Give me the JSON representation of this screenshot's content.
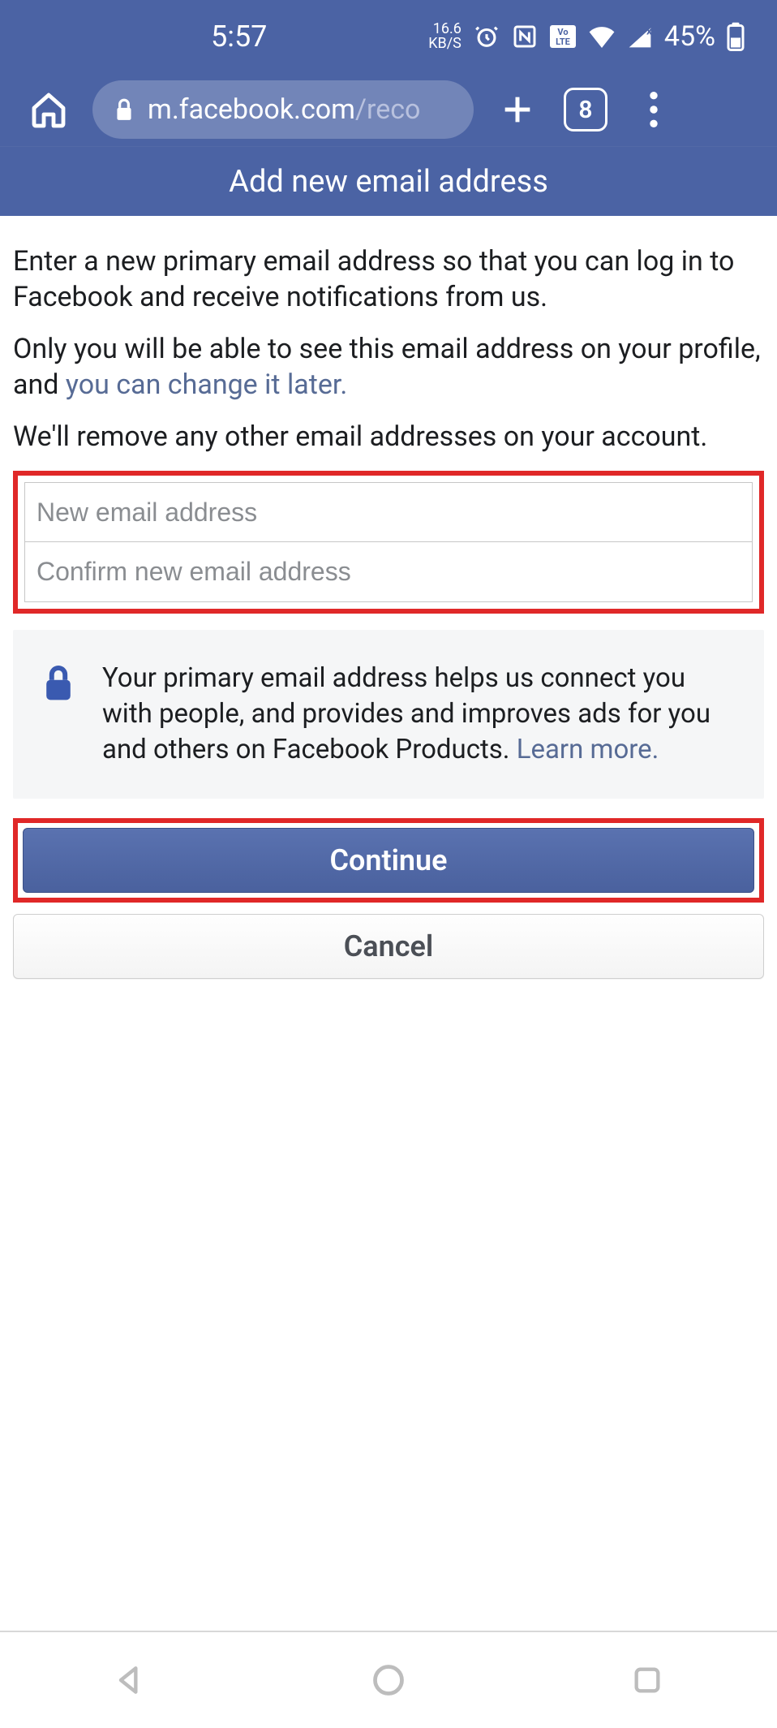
{
  "status": {
    "time": "5:57",
    "speed_value": "16.6",
    "speed_unit": "KB/S",
    "volte_label": "Vo\nLTE",
    "battery_pct": "45%"
  },
  "browser": {
    "url_host": "m.facebook.com",
    "url_path": "/reco",
    "tab_count": "8"
  },
  "page": {
    "title": "Add new email address",
    "intro": "Enter a new primary email address so that you can log in to Facebook and receive notifications from us.",
    "visibility_prefix": "Only you will be able to see this email address on your profile, and ",
    "visibility_link": "you can change it later.",
    "removal_note": "We'll remove any other email addresses on your account.",
    "input_new_placeholder": "New email address",
    "input_confirm_placeholder": "Confirm new email address",
    "info_text": "Your primary email address helps us connect you with people, and provides and improves ads for you and others on Facebook Products. ",
    "info_link": "Learn more.",
    "continue_label": "Continue",
    "cancel_label": "Cancel"
  }
}
